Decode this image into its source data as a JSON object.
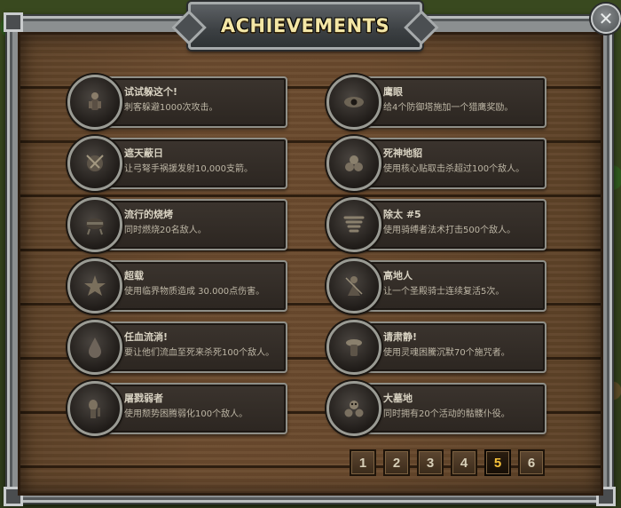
{
  "title": "ACHIEVEMENTS",
  "close_label": "✕",
  "achievements": [
    {
      "name": "试试躲这个!",
      "desc": "刺客躲避1000次攻击。",
      "icon": "assassin-icon"
    },
    {
      "name": "鹰眼",
      "desc": "给4个防御塔施加一个猎鹰奖励。",
      "icon": "eye-icon"
    },
    {
      "name": "遮天蔽日",
      "desc": "让弓弩手祸援发射10,000支箭。",
      "icon": "arrow-storm-icon"
    },
    {
      "name": "死神地貂",
      "desc": "使用核心贴取击杀超过100个敌人。",
      "icon": "skull-pile-icon"
    },
    {
      "name": "流行的烧烤",
      "desc": "同时燃烧20名敌人。",
      "icon": "bbq-grill-icon"
    },
    {
      "name": "除太 #5",
      "desc": "使用骑缚者法术打击500个敌人。",
      "icon": "tornado-icon"
    },
    {
      "name": "超载",
      "desc": "使用临界物质造成 30.000点伤害。",
      "icon": "overload-icon"
    },
    {
      "name": "高地人",
      "desc": "让一个圣殿骑士连续复活5次。",
      "icon": "highlander-icon"
    },
    {
      "name": "任血流淌!",
      "desc": "要让他们流血至死来杀死100个敌人。",
      "icon": "blood-drop-icon"
    },
    {
      "name": "请肃静!",
      "desc": "使用灵魂困騰沉默70个施咒者。",
      "icon": "silence-icon"
    },
    {
      "name": "屠戮弱者",
      "desc": "使用颓势困腾弱化100个敌人。",
      "icon": "weak-foe-icon"
    },
    {
      "name": "大墓地",
      "desc": "同时拥有20个活动的骷髅仆役。",
      "icon": "skull-icon"
    }
  ],
  "pages": [
    "1",
    "2",
    "3",
    "4",
    "5",
    "6"
  ],
  "current_page": "5",
  "colors": {
    "title_text": "#f3e6a6",
    "active_page": "#f6c23a",
    "card_bg": "#2c2621",
    "wood": "#6b4b2e"
  }
}
